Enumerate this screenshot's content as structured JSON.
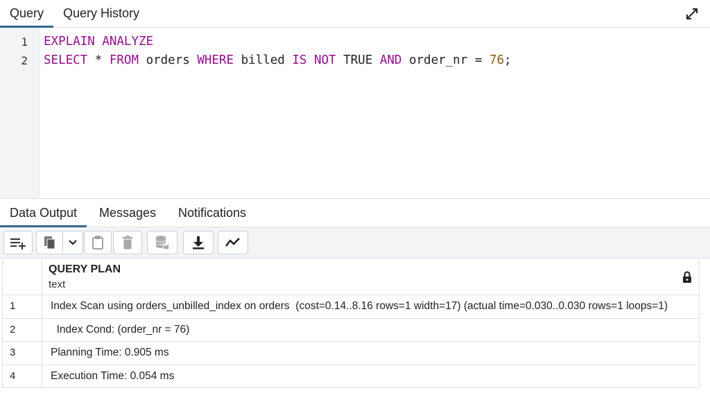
{
  "query_tabs": [
    {
      "label": "Query",
      "active": true
    },
    {
      "label": "Query History",
      "active": false
    }
  ],
  "editor": {
    "line_numbers": [
      "1",
      "2"
    ],
    "line1": {
      "kw1": "EXPLAIN",
      "kw2": "ANALYZE"
    },
    "line2": {
      "select": "SELECT",
      "star": "*",
      "from": "FROM",
      "table": "orders",
      "where": "WHERE",
      "col": "billed",
      "is": "IS",
      "not": "NOT",
      "val": "TRUE",
      "and": "AND",
      "col2": "order_nr",
      "op": "=",
      "num": "76",
      "semi": ";"
    }
  },
  "output_tabs": [
    {
      "label": "Data Output",
      "active": true
    },
    {
      "label": "Messages",
      "active": false
    },
    {
      "label": "Notifications",
      "active": false
    }
  ],
  "toolbar": {
    "icons": [
      "add-row-icon",
      "copy-icon",
      "chevron-down-icon",
      "paste-icon",
      "delete-icon",
      "save-data-icon",
      "download-icon",
      "graph-icon"
    ]
  },
  "grid": {
    "column": {
      "name": "QUERY PLAN",
      "type": "text"
    },
    "rows": [
      {
        "num": "1",
        "value": "Index Scan using orders_unbilled_index on orders  (cost=0.14..8.16 rows=1 width=17) (actual time=0.030..0.030 rows=1 loops=1)"
      },
      {
        "num": "2",
        "value": "  Index Cond: (order_nr = 76)"
      },
      {
        "num": "3",
        "value": "Planning Time: 0.905 ms"
      },
      {
        "num": "4",
        "value": "Execution Time: 0.054 ms"
      }
    ]
  },
  "colors": {
    "accent": "#326690",
    "keyword": "#930e8c",
    "number": "#8a5a12"
  }
}
